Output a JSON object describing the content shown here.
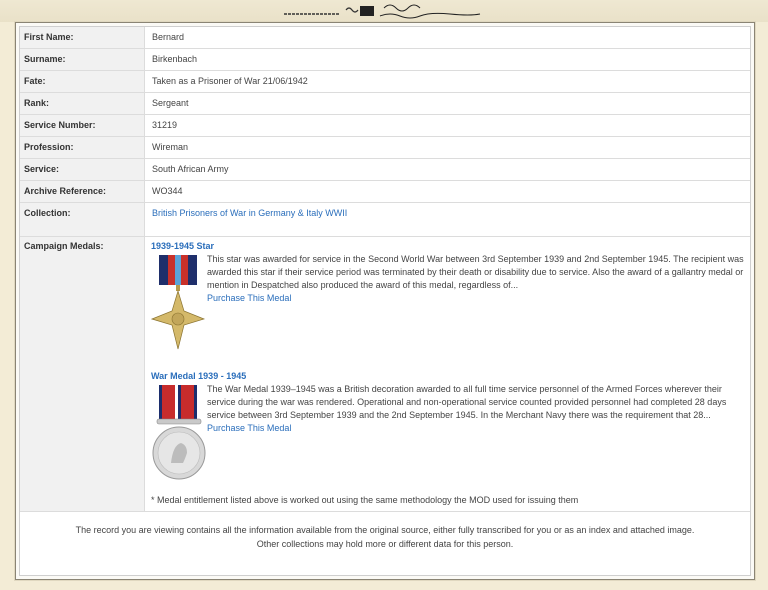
{
  "record": {
    "rows": [
      {
        "label": "First Name:",
        "value": "Bernard"
      },
      {
        "label": "Surname:",
        "value": "Birkenbach"
      },
      {
        "label": "Fate:",
        "value": "Taken as a Prisoner of War 21/06/1942"
      },
      {
        "label": "Rank:",
        "value": "Sergeant"
      },
      {
        "label": "Service Number:",
        "value": "31219"
      },
      {
        "label": "Profession:",
        "value": "Wireman"
      },
      {
        "label": "Service:",
        "value": "South African Army"
      },
      {
        "label": "Archive Reference:",
        "value": "WO344"
      }
    ],
    "collection_label": "Collection:",
    "collection_value": "British Prisoners of War in Germany & Italy WWII",
    "campaign_label": "Campaign Medals:"
  },
  "medals": [
    {
      "title": "1939-1945 Star",
      "description": "This star was awarded for service in the Second World War between 3rd September 1939 and 2nd September 1945. The recipient was awarded this star if their service period was terminated by their death or disability due to service. Also the award of a gallantry medal or mention in Despatched also produced the award of this medal, regardless of...",
      "purchase": "Purchase This Medal"
    },
    {
      "title": "War Medal 1939 - 1945",
      "description": "The War Medal 1939–1945 was a British decoration awarded to all full time service personnel of the Armed Forces wherever their service during the war was rendered. Operational and non-operational service counted provided personnel had completed 28 days service between 3rd September 1939 and the 2nd September 1945. In the Merchant Navy there was the requirement that 28...",
      "purchase": "Purchase This Medal"
    }
  ],
  "footnote": "* Medal entitlement listed above is worked out using the same methodology the MOD used for issuing them",
  "footer": {
    "line1": "The record you are viewing contains all the information available from the original source, either fully transcribed for you or as an index and attached image.",
    "line2": "Other collections may hold more or different data for this person."
  }
}
